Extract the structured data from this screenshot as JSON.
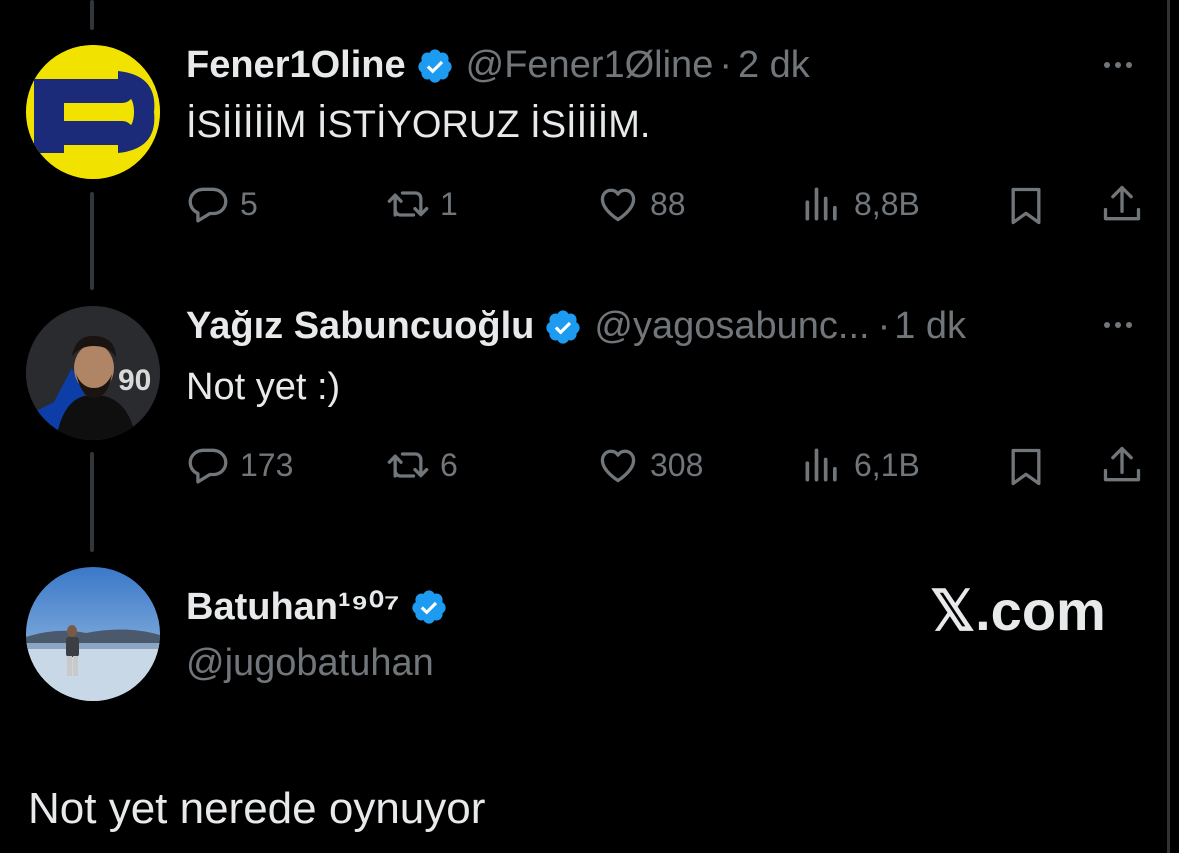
{
  "tweets": [
    {
      "display_name": "Fener1Oline",
      "handle": "@Fener1Øline",
      "separator": "·",
      "time": "2 dk",
      "text": "İSİİİİİM İSTİYORUZ İSİİİİM.",
      "replies": "5",
      "retweets": "1",
      "likes": "88",
      "views": "8,8B"
    },
    {
      "display_name": "Yağız Sabuncuoğlu",
      "handle": "@yagosabunc...",
      "separator": "·",
      "time": "1 dk",
      "text": "Not yet :)",
      "replies": "173",
      "retweets": "6",
      "likes": "308",
      "views": "6,1B"
    }
  ],
  "author": {
    "display_name": "Batuhan¹⁹⁰⁷",
    "handle": "@jugobatuhan"
  },
  "main_text": "Not yet nerede oynuyor",
  "watermark": "𝕏.com",
  "colors": {
    "background": "#000000",
    "text": "#e7e9ea",
    "muted": "#71767b",
    "verified": "#1d9bf0",
    "logo_yellow": "#f2e200",
    "logo_blue": "#1c2a7a"
  }
}
